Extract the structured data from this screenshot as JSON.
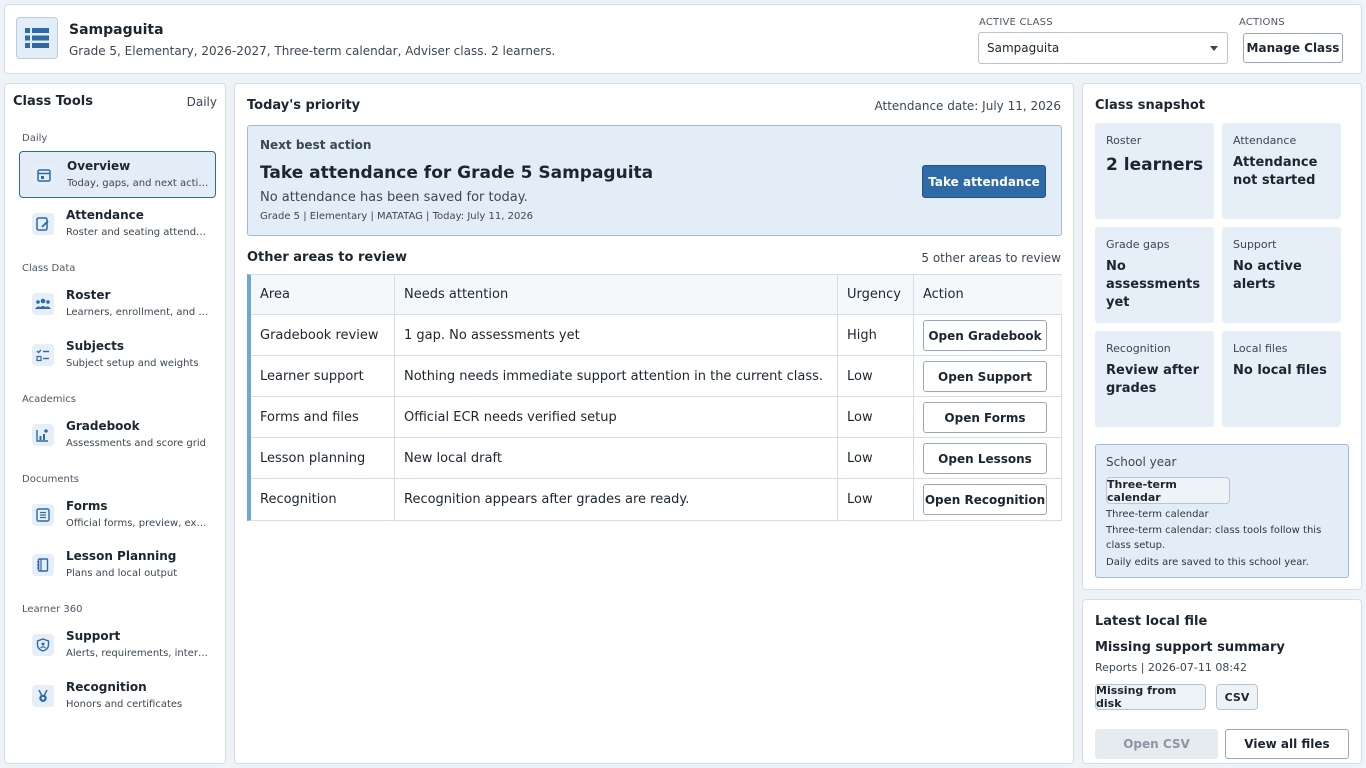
{
  "header": {
    "title": "Sampaguita",
    "subtitle": "Grade 5, Elementary, 2026-2027, Three-term calendar, Adviser class. 2 learners.",
    "active_class_label": "ACTIVE CLASS",
    "active_class_value": "Sampaguita",
    "actions_label": "ACTIONS",
    "manage_class_label": "Manage Class"
  },
  "sidebar": {
    "title": "Class Tools",
    "mode": "Daily",
    "groups": [
      "Daily",
      "Class Data",
      "Academics",
      "Documents",
      "Learner 360"
    ],
    "items": [
      {
        "label": "Overview",
        "desc": "Today, gaps, and next actions",
        "icon": "calendar-icon"
      },
      {
        "label": "Attendance",
        "desc": "Roster and seating attendance",
        "icon": "edit-icon"
      },
      {
        "label": "Roster",
        "desc": "Learners, enrollment, and im...",
        "icon": "people-icon"
      },
      {
        "label": "Subjects",
        "desc": "Subject setup and weights",
        "icon": "checklist-icon"
      },
      {
        "label": "Gradebook",
        "desc": "Assessments and score grid",
        "icon": "chart-add-icon"
      },
      {
        "label": "Forms",
        "desc": "Official forms, preview, export",
        "icon": "form-icon"
      },
      {
        "label": "Lesson Planning",
        "desc": "Plans and local output",
        "icon": "notebook-icon"
      },
      {
        "label": "Support",
        "desc": "Alerts, requirements, interve...",
        "icon": "shield-icon"
      },
      {
        "label": "Recognition",
        "desc": "Honors and certificates",
        "icon": "medal-icon"
      }
    ]
  },
  "main": {
    "priority_title": "Today's priority",
    "attendance_date": "Attendance date: July 11, 2026",
    "next_action_eyebrow": "Next best action",
    "next_action_title": "Take attendance for Grade 5 Sampaguita",
    "next_action_message": "No attendance has been saved for today.",
    "next_action_meta": "Grade 5 | Elementary | MATATAG | Today: July 11, 2026",
    "take_attendance_label": "Take attendance",
    "other_title": "Other areas to review",
    "other_count": "5 other areas to review",
    "table": {
      "headers": [
        "Area",
        "Needs attention",
        "Urgency",
        "Action"
      ],
      "rows": [
        {
          "area": "Gradebook review",
          "needs": "1 gap. No assessments yet",
          "urgency": "High",
          "action": "Open Gradebook"
        },
        {
          "area": "Learner support",
          "needs": "Nothing needs immediate support attention in the current class.",
          "urgency": "Low",
          "action": "Open Support"
        },
        {
          "area": "Forms and files",
          "needs": "Official ECR needs verified setup",
          "urgency": "Low",
          "action": "Open Forms"
        },
        {
          "area": "Lesson planning",
          "needs": "New local draft",
          "urgency": "Low",
          "action": "Open Lessons"
        },
        {
          "area": "Recognition",
          "needs": "Recognition appears after grades are ready.",
          "urgency": "Low",
          "action": "Open Recognition"
        }
      ]
    }
  },
  "snapshot": {
    "title": "Class snapshot",
    "cards": [
      {
        "key": "Roster",
        "value": "2 learners"
      },
      {
        "key": "Attendance",
        "value": "Attendance not started"
      },
      {
        "key": "Grade gaps",
        "value": "No assessments yet"
      },
      {
        "key": "Support",
        "value": "No active alerts"
      },
      {
        "key": "Recognition",
        "value": "Review after grades"
      },
      {
        "key": "Local files",
        "value": "No local files"
      }
    ],
    "school_year": {
      "title": "School year",
      "chip": "Three-term calendar",
      "line1": "Three-term calendar",
      "line2": "Three-term calendar: class tools follow this class setup.",
      "line3": "Daily edits are saved to this school year."
    }
  },
  "latest": {
    "title": "Latest local file",
    "file_name": "Missing support summary",
    "file_meta": "Reports | 2026-07-11 08:42",
    "chip_status": "Missing from disk",
    "chip_type": "CSV",
    "open_csv_label": "Open CSV",
    "view_all_label": "View all files"
  },
  "colors": {
    "accent": "#2d6aa6",
    "accent_light": "#e3edf7",
    "table_bar": "#6ea6d8"
  }
}
